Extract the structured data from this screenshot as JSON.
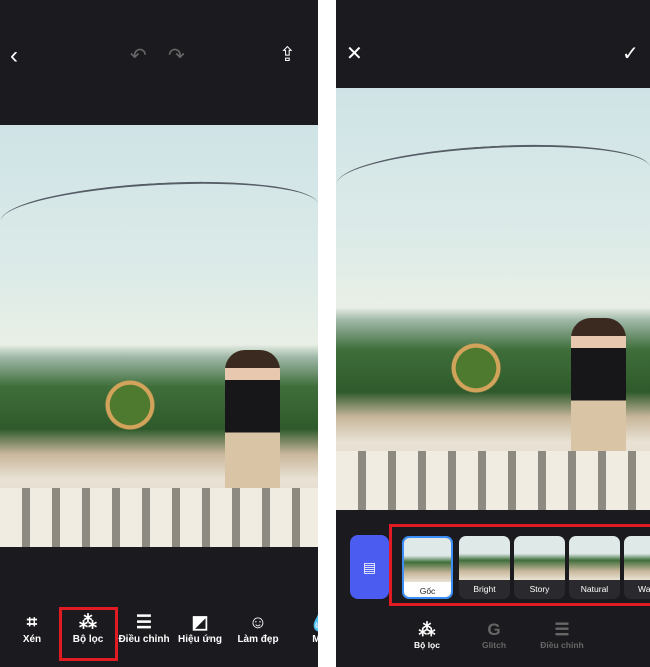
{
  "left": {
    "header": {
      "back_icon": "chevron-left",
      "undo_icon": "undo",
      "redo_icon": "redo",
      "share_icon": "share"
    },
    "toolbar": [
      {
        "label": "Xén",
        "icon": "crop"
      },
      {
        "label": "Bộ lọc",
        "icon": "filter-circles"
      },
      {
        "label": "Điều chỉnh",
        "icon": "sliders"
      },
      {
        "label": "Hiệu ứng",
        "icon": "effects"
      },
      {
        "label": "Làm đẹp",
        "icon": "beauty-face"
      },
      {
        "label": "Mờ",
        "icon": "blur-drop"
      }
    ],
    "highlight_color": "#e01b24"
  },
  "right": {
    "header": {
      "close_icon": "close",
      "confirm_icon": "checkmark"
    },
    "store_icon": "store",
    "filters": [
      {
        "label": "Gốc",
        "selected": true
      },
      {
        "label": "Bright"
      },
      {
        "label": "Story"
      },
      {
        "label": "Natural"
      },
      {
        "label": "Wa"
      }
    ],
    "tabs": [
      {
        "label": "Bộ lọc",
        "icon": "filter-circles",
        "active": true
      },
      {
        "label": "Glitch",
        "icon": "glitch-g"
      },
      {
        "label": "Điều chỉnh",
        "icon": "sliders"
      }
    ],
    "accent_color": "#3a8ef5",
    "store_color": "#4b5cf0"
  }
}
